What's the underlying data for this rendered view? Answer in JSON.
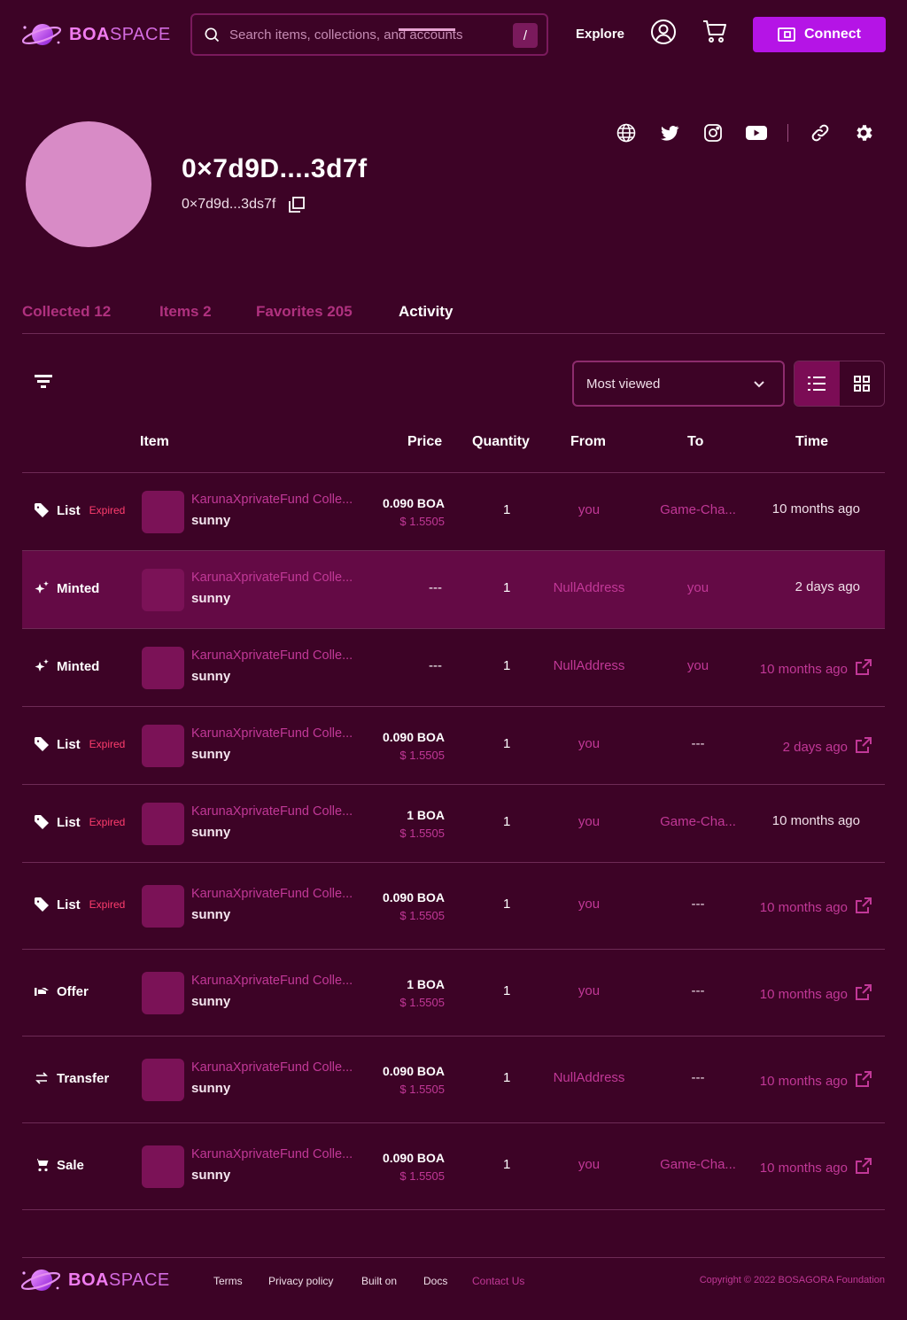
{
  "header": {
    "brand_bold": "BOA",
    "brand_light": "SPACE",
    "search_placeholder": "Search items, collections, and accounts",
    "search_shortcut": "/",
    "explore_label": "Explore",
    "connect_label": "Connect",
    "icons": [
      "account-icon",
      "cart-icon",
      "wallet-icon"
    ]
  },
  "profile": {
    "display_name": "0×7d9D....3d7f",
    "address": "0×7d9d...3ds7f",
    "social_icons": [
      "globe-icon",
      "twitter-icon",
      "instagram-icon",
      "youtube-icon",
      "link-icon",
      "settings-icon"
    ]
  },
  "tabs": [
    {
      "label": "Collected  12"
    },
    {
      "label": "Items 2"
    },
    {
      "label": "Favorites 205"
    },
    {
      "label": "Activity",
      "active": true
    }
  ],
  "toolbar": {
    "sort_value": "Most viewed",
    "view_modes": [
      "list-view",
      "grid-view"
    ],
    "active_view": "list-view"
  },
  "table": {
    "headers": {
      "item": "Item",
      "price": "Price",
      "quantity": "Quantity",
      "from": "From",
      "to": "To",
      "time": "Time"
    },
    "rows": [
      {
        "event": "List",
        "icon": "tag-icon",
        "badge": "Expired",
        "item_name": "KarunaXprivateFund Colle...",
        "item_sub": "sunny",
        "price": "0.090 BOA",
        "price_usd": "$ 1.5505",
        "quantity": "1",
        "from": "you",
        "to": "Game-Cha...",
        "time": "10 months ago",
        "time_link": false
      },
      {
        "event": "Minted",
        "icon": "sparkle-icon",
        "badge": "",
        "item_name": "KarunaXprivateFund Colle...",
        "item_sub": "sunny",
        "price": "---",
        "price_usd": "",
        "quantity": "1",
        "from": "NullAddress",
        "to": "you",
        "time": "2 days ago",
        "time_link": false,
        "highlighted": true
      },
      {
        "event": "Minted",
        "icon": "sparkle-icon",
        "badge": "",
        "item_name": "KarunaXprivateFund Colle...",
        "item_sub": "sunny",
        "price": "---",
        "price_usd": "",
        "quantity": "1",
        "from": "NullAddress",
        "to": "you",
        "time": "10 months ago",
        "time_link": true
      },
      {
        "event": "List",
        "icon": "tag-icon",
        "badge": "Expired",
        "item_name": "KarunaXprivateFund Colle...",
        "item_sub": "sunny",
        "price": "0.090 BOA",
        "price_usd": "$ 1.5505",
        "quantity": "1",
        "from": "you",
        "to": "---",
        "time": "2 days ago",
        "time_link": true
      },
      {
        "event": "List",
        "icon": "tag-icon",
        "badge": "Expired",
        "item_name": "KarunaXprivateFund Colle...",
        "item_sub": "sunny",
        "price": "1 BOA",
        "price_usd": "$ 1.5505",
        "quantity": "1",
        "from": "you",
        "to": "Game-Cha...",
        "time": "10 months ago",
        "time_link": false
      },
      {
        "event": "List",
        "icon": "tag-icon",
        "badge": "Expired",
        "item_name": "KarunaXprivateFund Colle...",
        "item_sub": "sunny",
        "price": "0.090 BOA",
        "price_usd": "$ 1.5505",
        "quantity": "1",
        "from": "you",
        "to": "---",
        "time": "10 months ago",
        "time_link": true
      },
      {
        "event": "Offer",
        "icon": "offer-icon",
        "badge": "",
        "item_name": "KarunaXprivateFund Colle...",
        "item_sub": "sunny",
        "price": "1 BOA",
        "price_usd": "$ 1.5505",
        "quantity": "1",
        "from": "you",
        "to": "---",
        "time": "10 months ago",
        "time_link": true
      },
      {
        "event": "Transfer",
        "icon": "transfer-icon",
        "badge": "",
        "item_name": "KarunaXprivateFund Colle...",
        "item_sub": "sunny",
        "price": "0.090 BOA",
        "price_usd": "$ 1.5505",
        "quantity": "1",
        "from": "NullAddress",
        "to": "---",
        "time": "10 months ago",
        "time_link": true
      },
      {
        "event": "Sale",
        "icon": "cart-icon",
        "badge": "",
        "item_name": "KarunaXprivateFund Colle...",
        "item_sub": "sunny",
        "price": "0.090 BOA",
        "price_usd": "$ 1.5505",
        "quantity": "1",
        "from": "you",
        "to": "Game-Cha...",
        "time": "10 months ago",
        "time_link": true
      }
    ]
  },
  "footer": {
    "brand_bold": "BOA",
    "brand_light": "SPACE",
    "links": [
      "Terms",
      "Privacy policy",
      "Built on",
      "Docs",
      "Contact Us"
    ],
    "copyright": "Copyright © 2022 BOSAGORA Foundation"
  },
  "colors": {
    "background": "#3d0326",
    "accent": "#b514e6",
    "link": "#c13897",
    "expired": "#ff3d6e",
    "highlight_row": "#640a45"
  }
}
